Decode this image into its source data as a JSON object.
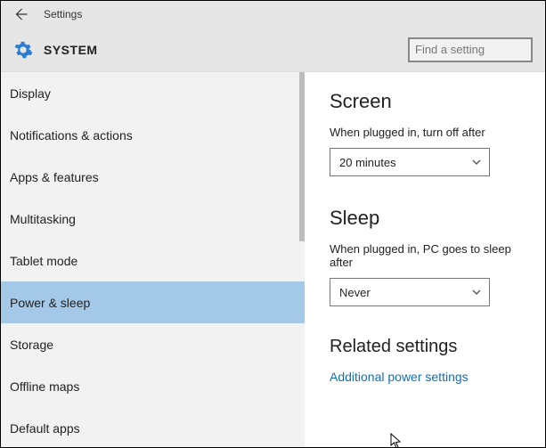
{
  "window": {
    "title": "Settings"
  },
  "header": {
    "title": "SYSTEM",
    "search_placeholder": "Find a setting"
  },
  "sidebar": {
    "items": [
      {
        "label": "Display"
      },
      {
        "label": "Notifications & actions"
      },
      {
        "label": "Apps & features"
      },
      {
        "label": "Multitasking"
      },
      {
        "label": "Tablet mode"
      },
      {
        "label": "Power & sleep"
      },
      {
        "label": "Storage"
      },
      {
        "label": "Offline maps"
      },
      {
        "label": "Default apps"
      }
    ],
    "selected_index": 5
  },
  "main": {
    "screen": {
      "title": "Screen",
      "plugged_label": "When plugged in, turn off after",
      "plugged_value": "20 minutes"
    },
    "sleep": {
      "title": "Sleep",
      "plugged_label": "When plugged in, PC goes to sleep after",
      "plugged_value": "Never"
    },
    "related": {
      "title": "Related settings",
      "link": "Additional power settings"
    }
  }
}
